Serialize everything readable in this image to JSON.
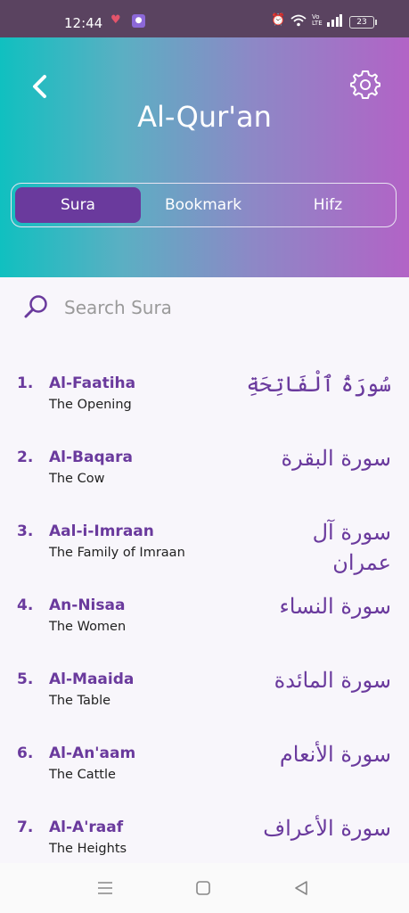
{
  "status_bar": {
    "time": "12:44",
    "battery": "23",
    "icons": [
      "app-notification-icon",
      "app-notification-icon",
      "alarm-icon",
      "wifi-icon",
      "volte-icon",
      "signal-icon",
      "battery-icon"
    ]
  },
  "header": {
    "title": "Al-Qur'an",
    "back_icon": "chevron-left-icon",
    "settings_icon": "gear-icon",
    "colors": {
      "gradient_start": "#10c0c0",
      "gradient_end": "#b263c6",
      "accent": "#6a3a9d"
    }
  },
  "tabs": [
    {
      "label": "Sura",
      "active": true
    },
    {
      "label": "Bookmark",
      "active": false
    },
    {
      "label": "Hifz",
      "active": false
    }
  ],
  "search": {
    "placeholder": "Search Sura",
    "value": "",
    "icon": "search-icon"
  },
  "suras": [
    {
      "number": "1.",
      "name": "Al-Faatiha",
      "meaning": "The Opening",
      "arabic": "سُورَةُ ٱلْفَاتِحَةِ"
    },
    {
      "number": "2.",
      "name": "Al-Baqara",
      "meaning": "The Cow",
      "arabic": "سورة البقرة"
    },
    {
      "number": "3.",
      "name": "Aal-i-Imraan",
      "meaning": "The Family of Imraan",
      "arabic": "سورة آل عمران"
    },
    {
      "number": "4.",
      "name": "An-Nisaa",
      "meaning": "The Women",
      "arabic": "سورة النساء"
    },
    {
      "number": "5.",
      "name": "Al-Maaida",
      "meaning": "The Table",
      "arabic": "سورة المائدة"
    },
    {
      "number": "6.",
      "name": "Al-An'aam",
      "meaning": "The Cattle",
      "arabic": "سورة الأنعام"
    },
    {
      "number": "7.",
      "name": "Al-A'raaf",
      "meaning": "The Heights",
      "arabic": "سورة الأعراف"
    }
  ],
  "nav_bar": {
    "icons": [
      "menu-icon",
      "home-icon",
      "back-icon"
    ]
  }
}
